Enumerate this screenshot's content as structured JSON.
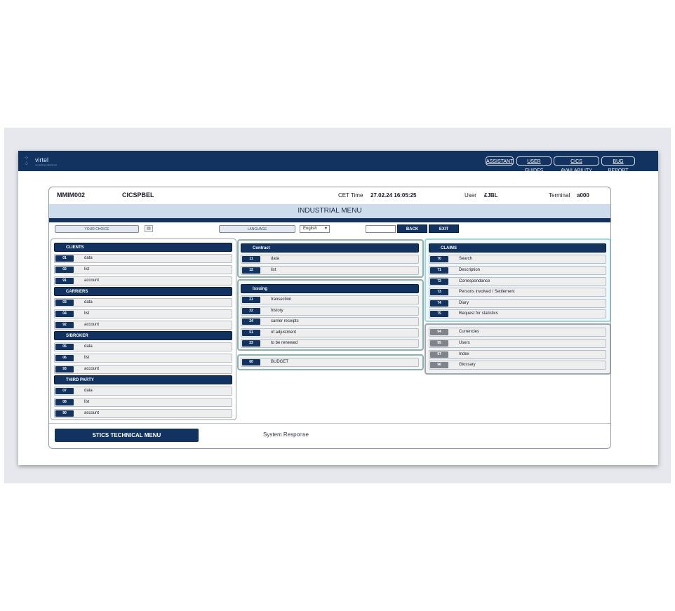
{
  "header": {
    "logo_text": "virtel",
    "logo_subtitle": "connecting mainframes",
    "links": [
      {
        "label": "ASSISTANT"
      },
      {
        "label": "USER GUIDES"
      },
      {
        "label": "CICS AVAILABILITY"
      },
      {
        "label": "BUG REPORT"
      }
    ]
  },
  "info": {
    "screen_id": "MMIM002",
    "system": "CICSPBEL",
    "time_label": "CET Time",
    "time_value": "27.02.24 16:05:25",
    "user_label": "User",
    "user_value": "£JBL",
    "terminal_label": "Terminal",
    "terminal_value": "a000"
  },
  "menu_title": "INDUSTRIAL MENU",
  "controls": {
    "choice_label": "YOUR CHOICE",
    "calendar_icon": "calendar-icon",
    "language_label": "LANGUAGE",
    "language_value": "English",
    "back_label": "BACK",
    "exit_label": "EXIT"
  },
  "left": {
    "sections": [
      {
        "title": "CLIENTS",
        "items": [
          {
            "code": "01",
            "label": "data"
          },
          {
            "code": "02",
            "label": "list"
          },
          {
            "code": "91",
            "label": "account"
          }
        ]
      },
      {
        "title": "CARRIERS",
        "items": [
          {
            "code": "03",
            "label": "data"
          },
          {
            "code": "04",
            "label": "list"
          },
          {
            "code": "92",
            "label": "account"
          }
        ]
      },
      {
        "title": "S/BROKER",
        "items": [
          {
            "code": "05",
            "label": "data"
          },
          {
            "code": "06",
            "label": "list"
          },
          {
            "code": "93",
            "label": "account"
          }
        ]
      },
      {
        "title": "THIRD PARTY",
        "items": [
          {
            "code": "07",
            "label": "data"
          },
          {
            "code": "08",
            "label": "list"
          },
          {
            "code": "90",
            "label": "account"
          }
        ]
      }
    ]
  },
  "middle": {
    "contract": {
      "title": "Contract",
      "items": [
        {
          "code": "11",
          "label": "data"
        },
        {
          "code": "12",
          "label": "list"
        }
      ]
    },
    "issuing": {
      "title": "Issuing",
      "items": [
        {
          "code": "21",
          "label": "transection"
        },
        {
          "code": "22",
          "label": "history"
        },
        {
          "code": "24",
          "label": "carrier receipts"
        },
        {
          "code": "51",
          "label": "of adjustment"
        },
        {
          "code": "23",
          "label": "to be renewed"
        }
      ]
    },
    "budget": {
      "code": "60",
      "label": "BUDGET"
    }
  },
  "right": {
    "claims": {
      "title": "CLAIMS",
      "items": [
        {
          "code": "70",
          "label": "Search"
        },
        {
          "code": "71",
          "label": "Description"
        },
        {
          "code": "72",
          "label": "Correspondance"
        },
        {
          "code": "73",
          "label": "Persons involved / Settlement"
        },
        {
          "code": "74",
          "label": "Diary"
        },
        {
          "code": "75",
          "label": "Request for statistics"
        }
      ]
    },
    "misc": {
      "items": [
        {
          "code": "94",
          "label": "Currencies"
        },
        {
          "code": "95",
          "label": "Users"
        },
        {
          "code": "97",
          "label": "Index"
        },
        {
          "code": "96",
          "label": "Glossary"
        }
      ]
    }
  },
  "footer": {
    "tech_menu_label": "STICS TECHNICAL MENU",
    "system_response_label": "System Response"
  }
}
